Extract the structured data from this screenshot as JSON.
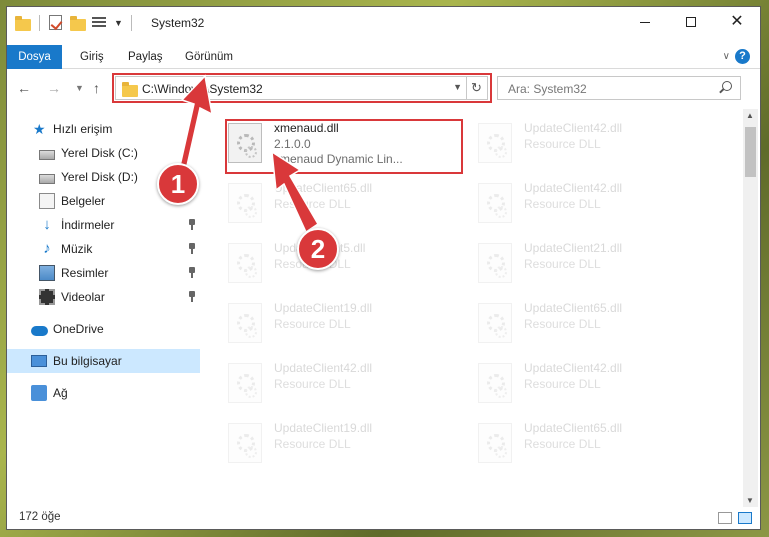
{
  "window": {
    "title": "System32"
  },
  "ribbon": {
    "tabs": [
      {
        "label": "Dosya"
      },
      {
        "label": "Giriş"
      },
      {
        "label": "Paylaş"
      },
      {
        "label": "Görünüm"
      }
    ]
  },
  "nav": {
    "address": "C:\\Windows\\System32",
    "search_placeholder": "Ara: System32"
  },
  "sidebar": {
    "items": [
      {
        "label": "Hızlı erişim"
      },
      {
        "label": "Yerel Disk (C:)"
      },
      {
        "label": "Yerel Disk (D:)"
      },
      {
        "label": "Belgeler"
      },
      {
        "label": "İndirmeler"
      },
      {
        "label": "Müzik"
      },
      {
        "label": "Resimler"
      },
      {
        "label": "Videolar"
      },
      {
        "label": "OneDrive"
      },
      {
        "label": "Bu bilgisayar"
      },
      {
        "label": "Ağ"
      }
    ]
  },
  "files": [
    {
      "name": "xmenaud.dll",
      "line2": "2.1.0.0",
      "line3": "xmenaud Dynamic Lin..."
    },
    {
      "name": "UpdateClient42.dll",
      "line2": "Resource DLL"
    },
    {
      "name": "UpdateClient65.dll",
      "line2": "Resource DLL"
    },
    {
      "name": "UpdateClient42.dll",
      "line2": "Resource DLL"
    },
    {
      "name": "UpdateClient5.dll",
      "line2": "Resource DLL"
    },
    {
      "name": "UpdateClient21.dll",
      "line2": "Resource DLL"
    },
    {
      "name": "UpdateClient19.dll",
      "line2": "Resource DLL"
    },
    {
      "name": "UpdateClient65.dll",
      "line2": "Resource DLL"
    },
    {
      "name": "UpdateClient42.dll",
      "line2": "Resource DLL"
    },
    {
      "name": "UpdateClient42.dll",
      "line2": "Resource DLL"
    },
    {
      "name": "UpdateClient19.dll",
      "line2": "Resource DLL"
    },
    {
      "name": "UpdateClient65.dll",
      "line2": "Resource DLL"
    }
  ],
  "status": {
    "count": "172 öğe"
  },
  "annotations": {
    "step1": "1",
    "step2": "2",
    "color": "#d9383a"
  },
  "colors": {
    "accent": "#1979ca",
    "selection": "#cce8ff"
  }
}
